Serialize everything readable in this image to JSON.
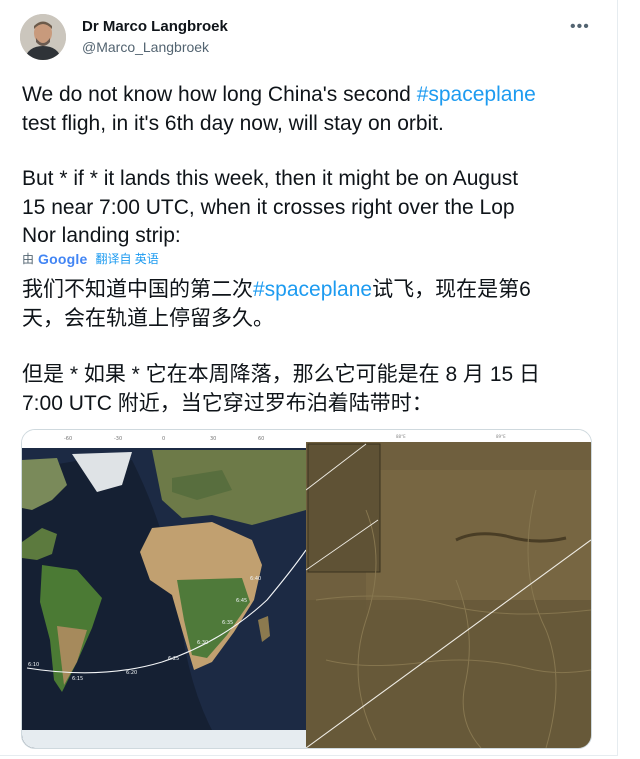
{
  "author": {
    "name": "Dr Marco Langbroek",
    "handle": "@Marco_Langbroek"
  },
  "menu": {
    "more_label": "•••"
  },
  "tweet": {
    "line1_pre": "We do not know how long China's second ",
    "hashtag": "#spaceplane",
    "line2": "test fligh, in it's 6th day now, will stay on orbit.",
    "line3": "But * if * it lands this week, then it might be on August",
    "line4": "15 near 7:00 UTC, when it crosses right over the Lop",
    "line5": "Nor landing strip:"
  },
  "translation": {
    "by_label": "由",
    "provider": "Google",
    "action": "翻译自 英语",
    "line1_pre": "我们不知道中国的第二次",
    "hashtag": "#spaceplane",
    "line1_post": "试飞，现在是第6",
    "line2": "天，会在轨道上停留多久。",
    "line3": "但是 * 如果 * 它在本周降落，那么它可能是在 8 月 15 日",
    "line4": "7:00 UTC 附近，当它穿过罗布泊着陆带时："
  },
  "map": {
    "top_ticks": [
      "-60",
      "-30",
      "0",
      "30",
      "60"
    ],
    "track_labels": [
      "6:40",
      "6:45",
      "6:35",
      "6:30",
      "6:25",
      "6:20",
      "6:15",
      "6:10"
    ],
    "right_ticks": [
      "88°E",
      "89°E"
    ]
  },
  "colors": {
    "accent": "#1d9bf0",
    "secondary": "#536471"
  }
}
